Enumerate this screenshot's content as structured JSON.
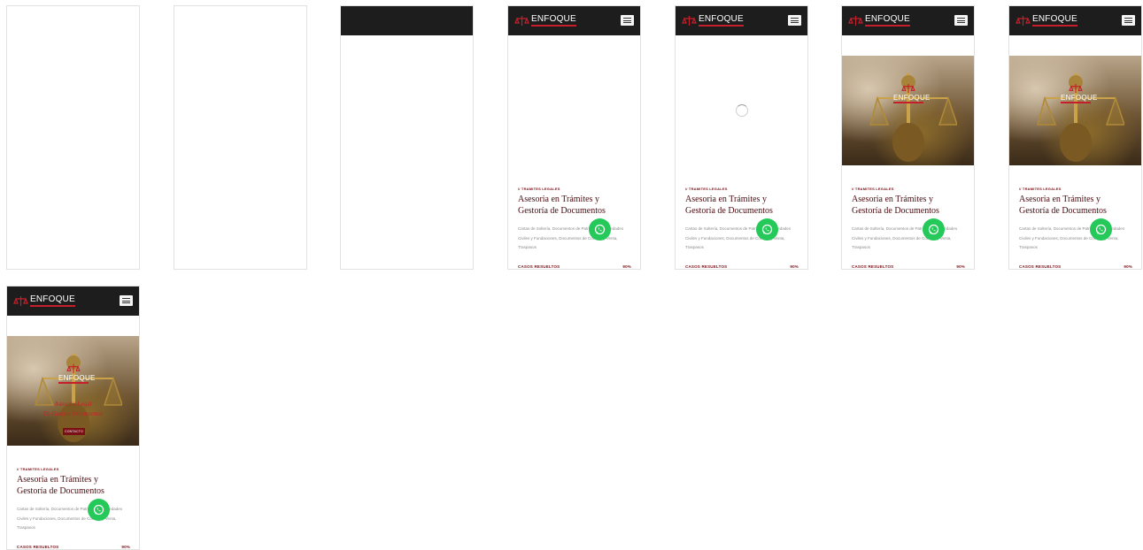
{
  "brand": {
    "logo_text": "ENFOQUE",
    "accent": "#c41f2b",
    "header_bg": "#1d1d1d",
    "primary": "#7a0f16",
    "whatsapp_color": "#25c95a"
  },
  "hero": {
    "tagline_1": "Asesoría Legal",
    "tagline_2": "En Gestión Documental",
    "cta_label": "CONTACTO"
  },
  "section": {
    "kicker": "// TRAMITES LEGALES",
    "title": "Asesoria en Trámites y Gestoría de Documentos",
    "description": "Cartas de Soltería, Documentos de Patrimonio, Sociedades Civiles y Fundaciones, Documentos de Compra y Venta, Traspasos"
  },
  "stats": {
    "label": "CASOS RESUELTOS",
    "value": "90%"
  },
  "icons": {
    "menu": "hamburger-menu-icon",
    "whatsapp": "whatsapp-icon",
    "logo": "justice-scale-logo-icon",
    "loader": "loading-spinner-icon"
  },
  "frames": [
    {
      "state": "blank"
    },
    {
      "state": "blank"
    },
    {
      "state": "header-only"
    },
    {
      "state": "content-no-hero"
    },
    {
      "state": "content-loading"
    },
    {
      "state": "hero-loaded"
    },
    {
      "state": "hero-loaded"
    },
    {
      "state": "hero-with-overlay"
    }
  ]
}
